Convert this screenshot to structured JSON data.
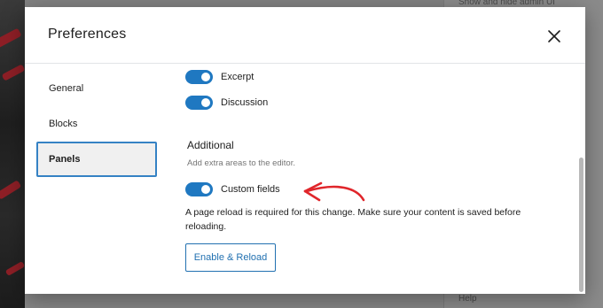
{
  "background": {
    "right_hint_top": "Show and hide admin UI",
    "right_hint_bottom": "Help"
  },
  "modal": {
    "title": "Preferences",
    "close_icon": "close-icon"
  },
  "sidebar": {
    "tabs": [
      {
        "label": "General",
        "selected": false
      },
      {
        "label": "Blocks",
        "selected": false
      },
      {
        "label": "Panels",
        "selected": true
      }
    ]
  },
  "panels": {
    "toggles": [
      {
        "label": "Excerpt",
        "on": true
      },
      {
        "label": "Discussion",
        "on": true
      }
    ],
    "additional": {
      "title": "Additional",
      "description": "Add extra areas to the editor.",
      "custom_fields": {
        "label": "Custom fields",
        "on": true
      },
      "notice": "A page reload is required for this change. Make sure your content is saved before reloading.",
      "button_label": "Enable & Reload"
    }
  },
  "colors": {
    "accent": "#2271b1",
    "toggle_on": "#1f78c1",
    "annotation_arrow": "#e0262b"
  }
}
